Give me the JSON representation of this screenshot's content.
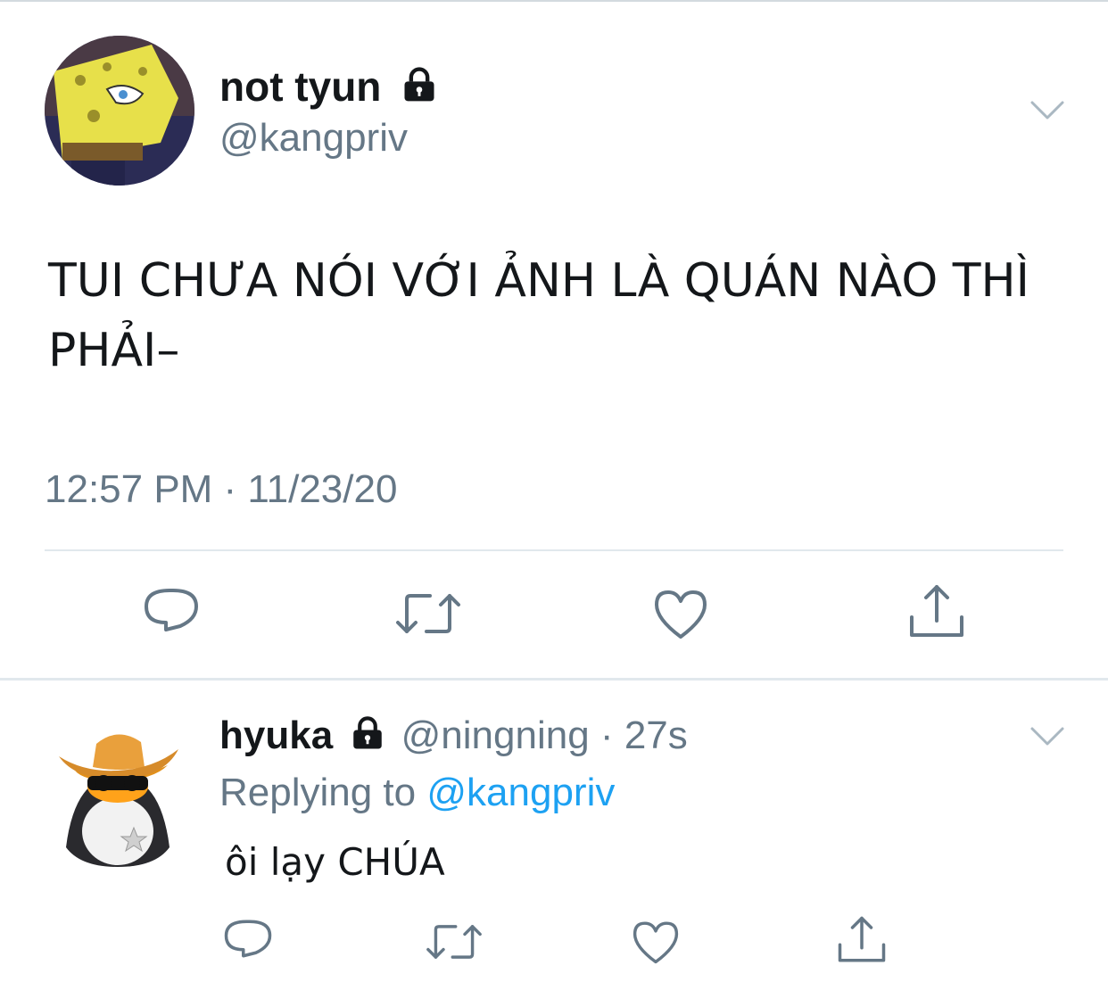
{
  "tweet": {
    "author_name": "not tyun",
    "author_handle": "@kangpriv",
    "text": "TUI CHƯA NÓI VỚI ẢNH LÀ QUÁN NÀO THÌ PHẢI–",
    "timestamp": "12:57 PM · 11/23/20",
    "locked_icon": "lock-icon",
    "menu_icon": "chevron-down-icon",
    "actions": [
      "reply-icon",
      "retweet-icon",
      "like-icon",
      "share-icon"
    ]
  },
  "reply": {
    "author_name": "hyuka",
    "author_handle": "@ningning",
    "separator": "·",
    "time": "27s",
    "replying_prefix": "Replying to",
    "replying_to": "@kangpriv",
    "text": "ôi lạy CHÚA",
    "locked_icon": "lock-icon",
    "menu_icon": "chevron-down-icon",
    "actions": [
      "reply-icon",
      "retweet-icon",
      "like-icon",
      "share-icon"
    ]
  },
  "colors": {
    "primary_text": "#14171a",
    "secondary_text": "#657786",
    "link": "#1da1f2",
    "divider": "#e1e8ed"
  }
}
